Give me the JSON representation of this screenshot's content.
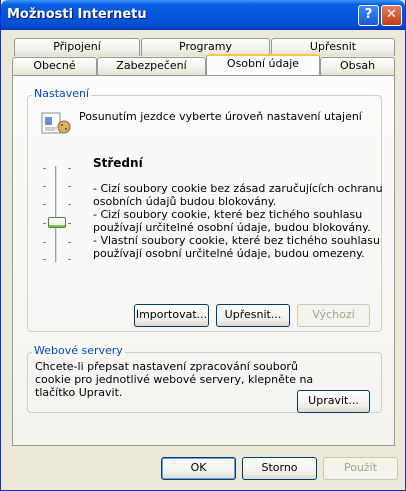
{
  "window": {
    "title": "Možnosti Internetu",
    "help_label": "?",
    "close_label": "✕"
  },
  "tabs": {
    "row1": [
      "Připojení",
      "Programy",
      "Upřesnit"
    ],
    "row2": [
      "Obecné",
      "Zabezpečení",
      "Osobní údaje",
      "Obsah"
    ],
    "active": "Osobní údaje"
  },
  "settings": {
    "group_label": "Nastavení",
    "instruction": "Posunutím jezdce vyberte úroveň nastavení utajení",
    "level_title": "Střední",
    "slider_level": "3 of 6",
    "description": [
      "- Cizí soubory cookie bez zásad zaručujících ochranu",
      "osobních údajů budou blokovány.",
      "- Cizí soubory cookie, které bez tichého souhlasu",
      "používají určitelné osobní údaje, budou blokovány.",
      "- Vlastní soubory cookie, které bez tichého souhlasu",
      "používají osobní určitelné údaje, budou omezeny."
    ],
    "import_label": "Importovat...",
    "advanced_label": "Upřesnit...",
    "default_label": "Výchozí"
  },
  "web_servers": {
    "group_label": "Webové servery",
    "description": [
      "Chcete-li přepsat nastavení zpracování souborů",
      "cookie pro jednotlivé webové servery, klepněte na",
      "tlačítko Upravit."
    ],
    "edit_label": "Upravit..."
  },
  "footer": {
    "ok_label": "OK",
    "cancel_label": "Storno",
    "apply_label": "Použít"
  }
}
